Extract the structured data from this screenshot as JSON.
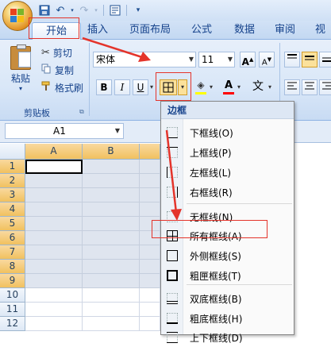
{
  "quick_access": {
    "icons": [
      "save-icon",
      "undo-icon",
      "redo-icon",
      "print-preview-icon",
      "customize-icon"
    ]
  },
  "tabs": [
    {
      "label": "开始",
      "active": true
    },
    {
      "label": "插入"
    },
    {
      "label": "页面布局"
    },
    {
      "label": "公式"
    },
    {
      "label": "数据"
    },
    {
      "label": "审阅"
    },
    {
      "label": "视图"
    }
  ],
  "clipboard": {
    "paste_label": "粘贴",
    "cut_label": "剪切",
    "copy_label": "复制",
    "format_painter_label": "格式刷",
    "group_label": "剪贴板"
  },
  "font": {
    "font_name": "宋体",
    "font_size": "11",
    "bold": "B",
    "italic": "I",
    "underline": "U",
    "grow_label": "A",
    "shrink_label": "A",
    "font_color_label": "A",
    "phonetic_label": "文"
  },
  "formula_bar": {
    "name_box": "A1"
  },
  "grid": {
    "columns": [
      "A",
      "B"
    ],
    "rows": [
      "1",
      "2",
      "3",
      "4",
      "5",
      "6",
      "7",
      "8",
      "9",
      "10",
      "11",
      "12"
    ]
  },
  "border_menu": {
    "title": "边框",
    "items": [
      {
        "label": "下框线(O)",
        "icon": "bottom-border-icon"
      },
      {
        "label": "上框线(P)",
        "icon": "top-border-icon"
      },
      {
        "label": "左框线(L)",
        "icon": "left-border-icon"
      },
      {
        "label": "右框线(R)",
        "icon": "right-border-icon"
      },
      {
        "label": "无框线(N)",
        "icon": "no-border-icon"
      },
      {
        "label": "所有框线(A)",
        "icon": "all-borders-icon"
      },
      {
        "label": "外侧框线(S)",
        "icon": "outside-borders-icon"
      },
      {
        "label": "粗匣框线(T)",
        "icon": "thick-box-border-icon"
      },
      {
        "label": "双底框线(B)",
        "icon": "double-bottom-border-icon"
      },
      {
        "label": "粗底框线(H)",
        "icon": "thick-bottom-border-icon"
      },
      {
        "label": "上下框线(D)",
        "icon": "top-bottom-border-icon"
      }
    ]
  },
  "colors": {
    "annotation_red": "#e4342b",
    "ribbon_blue": "#15428b"
  }
}
